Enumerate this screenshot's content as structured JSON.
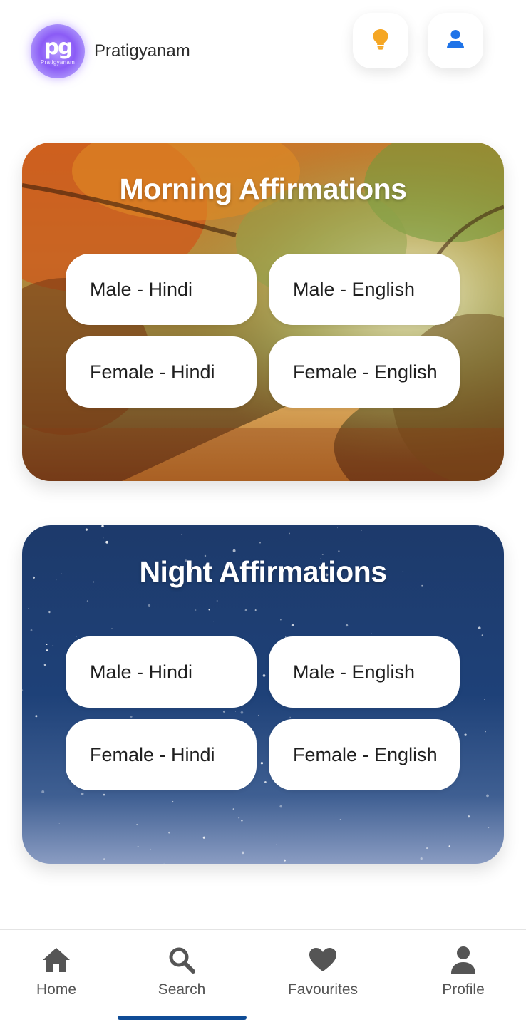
{
  "header": {
    "logo_mark": "pg",
    "logo_text": "Pratigyanam",
    "app_name": "Pratigyanam",
    "idea_icon": "lightbulb-icon",
    "user_icon": "user-icon"
  },
  "morning": {
    "title": "Morning Affirmations",
    "options": [
      "Male - Hindi",
      "Male - English",
      "Female - Hindi",
      "Female - English"
    ]
  },
  "night": {
    "title": "Night Affirmations",
    "options": [
      "Male - Hindi",
      "Male - English",
      "Female - Hindi",
      "Female - English"
    ]
  },
  "nav": {
    "items": [
      {
        "label": "Home",
        "icon": "home-icon"
      },
      {
        "label": "Search",
        "icon": "search-icon"
      },
      {
        "label": "Favourites",
        "icon": "heart-icon"
      },
      {
        "label": "Profile",
        "icon": "profile-icon"
      }
    ],
    "active_index": 1
  },
  "colors": {
    "accent": "#0f4c96",
    "idea": "#f5a623",
    "user": "#1e73e8",
    "nav_icon": "#555555"
  }
}
